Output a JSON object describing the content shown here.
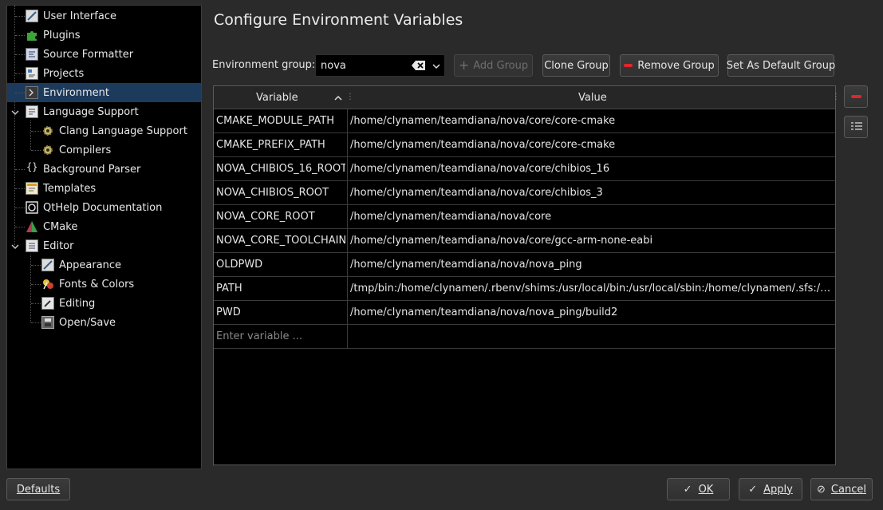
{
  "sidebar": {
    "items": [
      {
        "label": "User Interface",
        "icon": "user-interface-icon",
        "indent": 0
      },
      {
        "label": "Plugins",
        "icon": "plugin-puzzle-icon",
        "indent": 0
      },
      {
        "label": "Source Formatter",
        "icon": "source-formatter-icon",
        "indent": 0
      },
      {
        "label": "Projects",
        "icon": "projects-icon",
        "indent": 0
      },
      {
        "label": "Environment",
        "icon": "terminal-icon",
        "indent": 0,
        "selected": true
      },
      {
        "label": "Language Support",
        "icon": "language-support-icon",
        "indent": 0,
        "expanded": true
      },
      {
        "label": "Clang Language Support",
        "icon": "gear-icon",
        "indent": 1
      },
      {
        "label": "Compilers",
        "icon": "gear-icon",
        "indent": 1
      },
      {
        "label": "Background Parser",
        "icon": "braces-icon",
        "indent": 0
      },
      {
        "label": "Templates",
        "icon": "templates-icon",
        "indent": 0
      },
      {
        "label": "QtHelp Documentation",
        "icon": "qt-help-icon",
        "indent": 0
      },
      {
        "label": "CMake",
        "icon": "cmake-icon",
        "indent": 0
      },
      {
        "label": "Editor",
        "icon": "editor-icon",
        "indent": 0,
        "expanded": true
      },
      {
        "label": "Appearance",
        "icon": "appearance-icon",
        "indent": 1
      },
      {
        "label": "Fonts & Colors",
        "icon": "fonts-colors-icon",
        "indent": 1
      },
      {
        "label": "Editing",
        "icon": "editing-icon",
        "indent": 1
      },
      {
        "label": "Open/Save",
        "icon": "save-icon",
        "indent": 1
      }
    ]
  },
  "main": {
    "title": "Configure Environment Variables",
    "group_label": "Environment group:",
    "group_value": "nova",
    "buttons": {
      "add_group": "Add Group",
      "clone_group": "Clone Group",
      "remove_group": "Remove Group",
      "set_default": "Set As Default Group"
    },
    "table": {
      "columns": [
        "Variable",
        "Value"
      ],
      "rows": [
        {
          "variable": "CMAKE_MODULE_PATH",
          "value": "/home/clynamen/teamdiana/nova/core/core-cmake"
        },
        {
          "variable": "CMAKE_PREFIX_PATH",
          "value": "/home/clynamen/teamdiana/nova/core/core-cmake"
        },
        {
          "variable": "NOVA_CHIBIOS_16_ROOT",
          "value": "/home/clynamen/teamdiana/nova/core/chibios_16"
        },
        {
          "variable": "NOVA_CHIBIOS_ROOT",
          "value": "/home/clynamen/teamdiana/nova/core/chibios_3"
        },
        {
          "variable": "NOVA_CORE_ROOT",
          "value": "/home/clynamen/teamdiana/nova/core"
        },
        {
          "variable": "NOVA_CORE_TOOLCHAIN",
          "value": "/home/clynamen/teamdiana/nova/core/gcc-arm-none-eabi"
        },
        {
          "variable": "OLDPWD",
          "value": "/home/clynamen/teamdiana/nova/nova_ping"
        },
        {
          "variable": "PATH",
          "value": "/tmp/bin:/home/clynamen/.rbenv/shims:/usr/local/bin:/usr/local/sbin:/home/clynamen/.sfs:/home/..."
        },
        {
          "variable": "PWD",
          "value": "/home/clynamen/teamdiana/nova/nova_ping/build2"
        }
      ],
      "new_placeholder": "Enter variable ..."
    }
  },
  "footer": {
    "defaults": "Defaults",
    "ok": "OK",
    "apply": "Apply",
    "cancel": "Cancel"
  },
  "colors": {
    "selection": "#1c3a5c",
    "remove_red": "#e0262a",
    "background": "#2a2a2a"
  }
}
